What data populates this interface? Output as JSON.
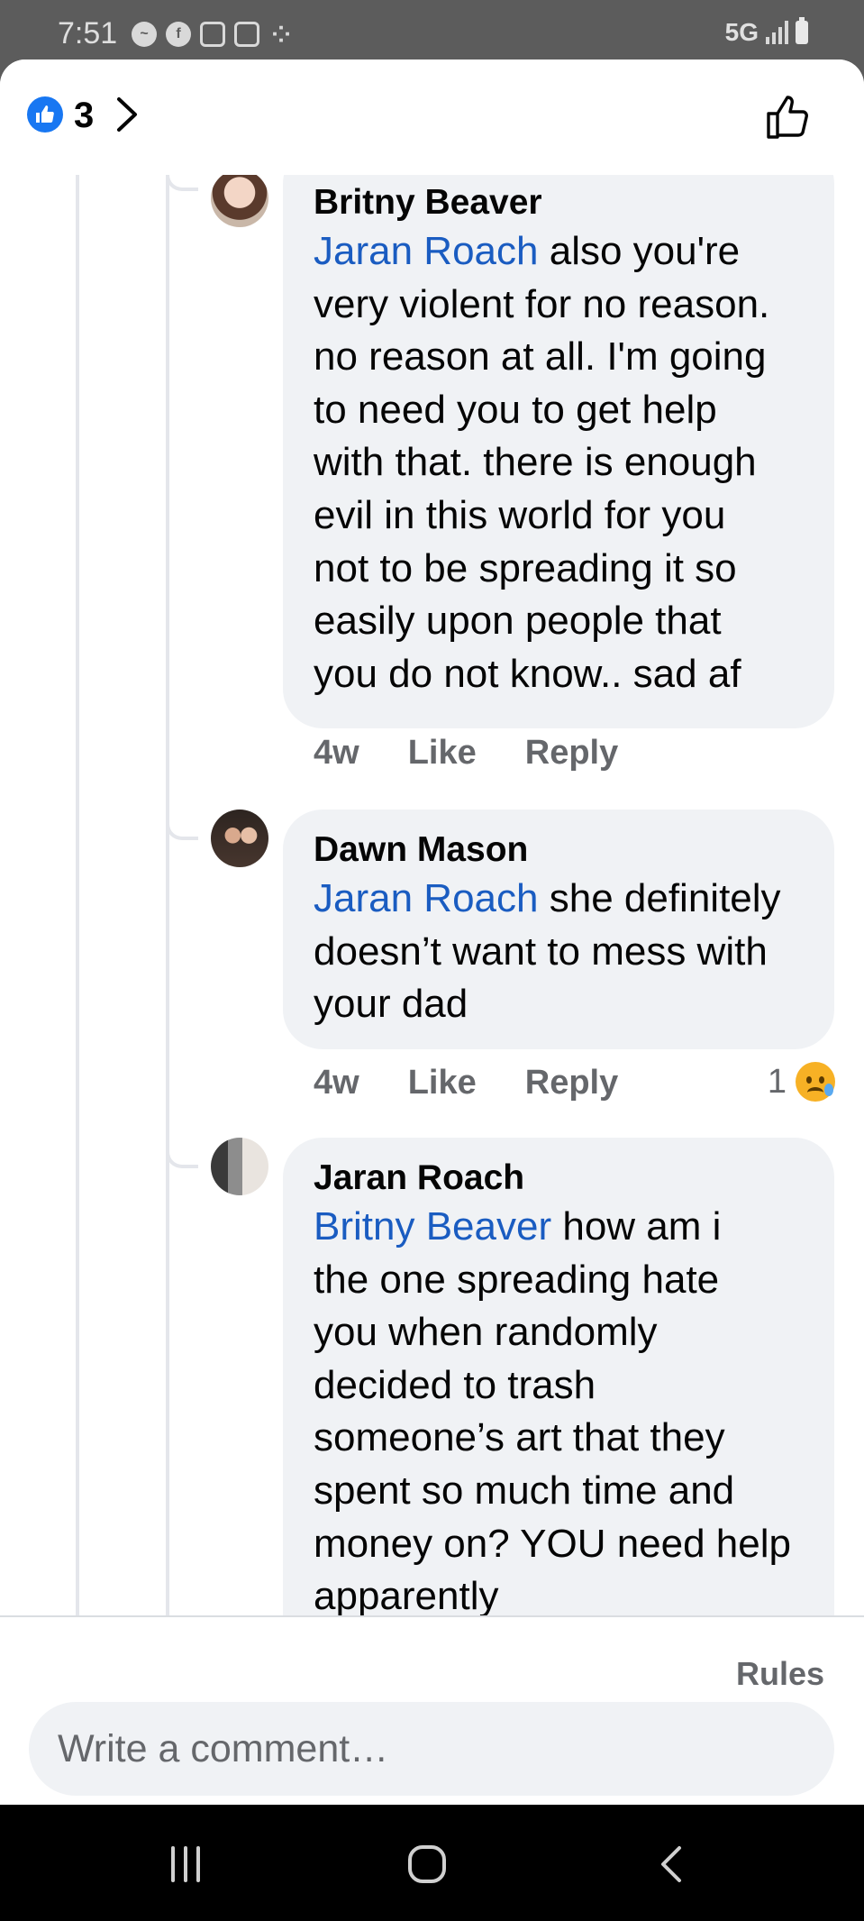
{
  "status_bar": {
    "time": "7:51",
    "network": "5G",
    "notification_icons": [
      "messenger-icon",
      "facebook-icon",
      "instagram-icon",
      "gallery-icon",
      "dots-icon"
    ]
  },
  "header": {
    "reaction_icon": "like-icon",
    "reaction_count": "3",
    "reaction_color": "#1877f2"
  },
  "comments": [
    {
      "author": "Britny Beaver",
      "mention": "Jaran Roach",
      "lines": [
        "also you're",
        "very violent for no reason.",
        "no reason at all. I'm going",
        "to need you to get help",
        "with that. there is enough",
        "evil in this world for you",
        "not to be spreading it so",
        "easily upon people that",
        "you do not know.. sad af"
      ],
      "time": "4w",
      "like_label": "Like",
      "reply_label": "Reply"
    },
    {
      "author": "Dawn Mason",
      "mention": "Jaran Roach",
      "lines": [
        "she definitely",
        "doesn’t want to mess with",
        "your dad"
      ],
      "time": "4w",
      "like_label": "Like",
      "reply_label": "Reply",
      "reaction_count": "1",
      "reaction_icon": "sad-face-icon"
    },
    {
      "author": "Jaran Roach",
      "mention": "Britny Beaver",
      "lines": [
        "how am i",
        "the one spreading hate",
        "you when randomly",
        "decided to trash",
        "someone’s art that they",
        "spent so much time and",
        "money on? YOU need help",
        "apparently"
      ]
    }
  ],
  "footer": {
    "rules_label": "Rules",
    "comment_placeholder": "Write a comment…"
  },
  "colors": {
    "mention": "#1a5cc1",
    "bubble": "#f0f2f5",
    "meta_text": "#65676b"
  }
}
